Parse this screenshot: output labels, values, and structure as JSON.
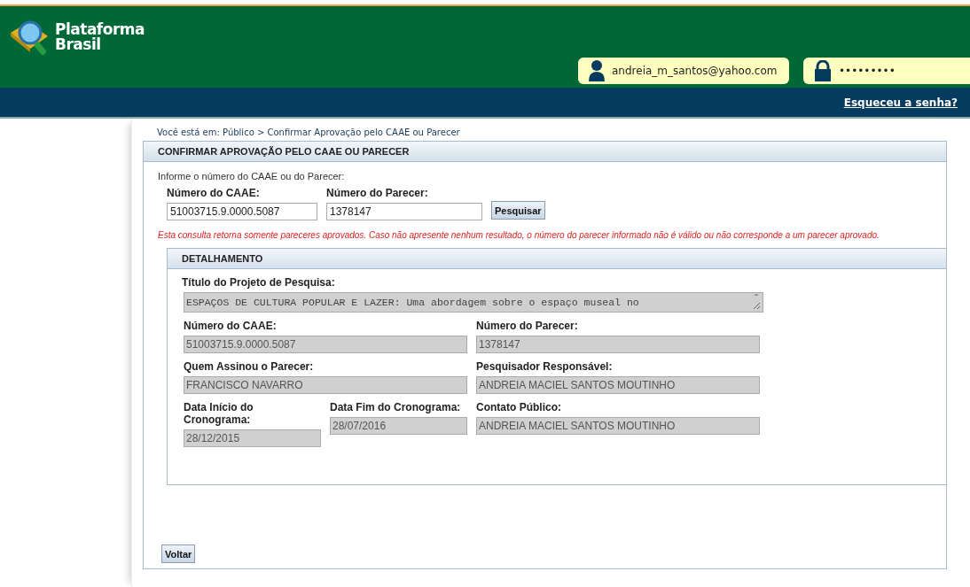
{
  "header": {
    "logo_lines": [
      "Plataforma",
      "Brasil"
    ],
    "login_email": "andreia_m_santos@yahoo.com",
    "login_password": "•••••••••",
    "forgot_link": "Esqueceu a senha?"
  },
  "breadcrumb": "Você está em: Público > Confirmar Aprovação pelo CAAE ou Parecer",
  "panel": {
    "title": "CONFIRMAR APROVAÇÃO PELO CAAE OU PARECER",
    "instruction": "Informe o número do CAAE ou do Parecer:",
    "search_fields": [
      {
        "label": "Número do CAAE:",
        "value": "51003715.9.0000.5087"
      },
      {
        "label": "Número do Parecer:",
        "value": "1378147"
      }
    ],
    "search_button": "Pesquisar",
    "warning": "Esta consulta retorna somente pareceres aprovados. Caso não apresente nenhum resultado, o número do parecer informado não é válido ou não corresponde a um parecer aprovado.",
    "detail": {
      "title": "DETALHAMENTO",
      "fields": [
        {
          "kind": "textarea",
          "label": "Título do Projeto de Pesquisa:",
          "value": "ESPAÇOS DE CULTURA POPULAR E LAZER: Uma abordagem sobre o espaço museal no"
        },
        {
          "kind": "half",
          "label": "Número do CAAE:",
          "value": "51003715.9.0000.5087"
        },
        {
          "kind": "half",
          "label": "Número do Parecer:",
          "value": "1378147"
        },
        {
          "kind": "half",
          "label": "Quem Assinou o Parecer:",
          "value": "FRANCISCO NAVARRO"
        },
        {
          "kind": "half",
          "label": "Pesquisador Responsável:",
          "value": "ANDREIA MACIEL SANTOS MOUTINHO"
        },
        {
          "kind": "quarter",
          "label": "Data Início do Cronograma:",
          "value": "28/12/2015"
        },
        {
          "kind": "quarter",
          "label": "Data Fim do Cronograma:",
          "value": "28/07/2016"
        },
        {
          "kind": "half",
          "label": "Contato Público:",
          "value": "ANDREIA MACIEL SANTOS MOUTINHO"
        }
      ]
    },
    "back_button": "Voltar"
  }
}
